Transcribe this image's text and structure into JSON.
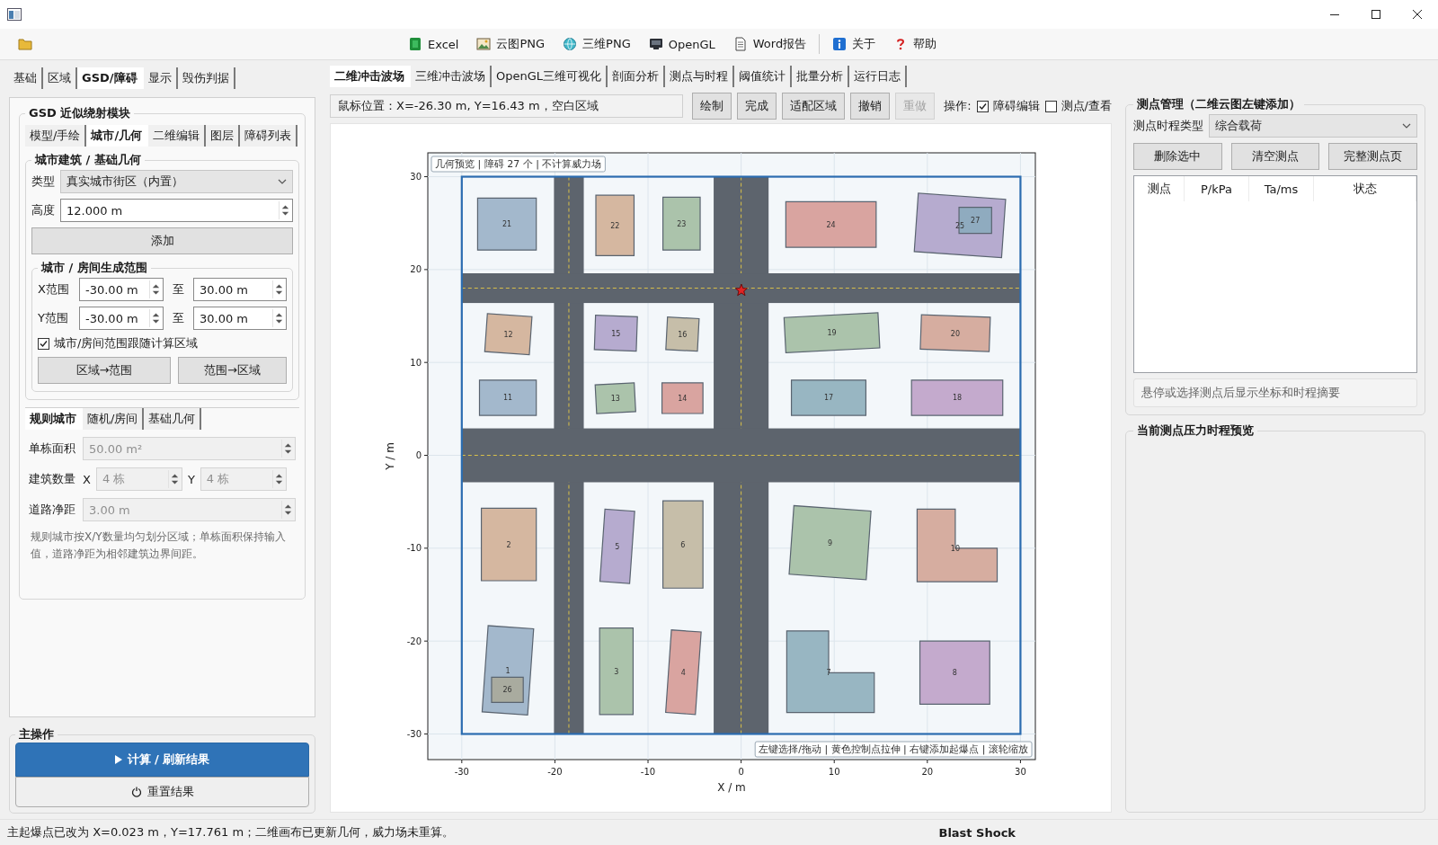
{
  "toolbar": {
    "groups": [
      [
        {
          "kind": "folder"
        }
      ],
      [
        {
          "kind": "excel",
          "label": "Excel"
        },
        {
          "kind": "image",
          "label": "云图PNG"
        },
        {
          "kind": "globe",
          "label": "三维PNG"
        },
        {
          "kind": "monitor",
          "label": "OpenGL"
        },
        {
          "kind": "document",
          "label": "Word报告"
        }
      ],
      [
        {
          "kind": "info",
          "label": "关于"
        },
        {
          "kind": "help",
          "label": "帮助"
        }
      ]
    ]
  },
  "left_panel": {
    "tabs": [
      {
        "label": "基础",
        "selected": false
      },
      {
        "label": "区域",
        "selected": false
      },
      {
        "label": "GSD/障碍",
        "selected": true
      },
      {
        "label": "显示",
        "selected": false
      },
      {
        "label": "毁伤判据",
        "selected": false
      }
    ],
    "module": {
      "title": "GSD 近似绕射模块",
      "tabs": [
        {
          "label": "模型/手绘",
          "selected": false
        },
        {
          "label": "城市/几何",
          "selected": true
        },
        {
          "label": "二维编辑",
          "selected": false
        },
        {
          "label": "图层",
          "selected": false
        },
        {
          "label": "障碍列表",
          "selected": false
        }
      ],
      "geometry": {
        "title": "城市建筑 / 基础几何",
        "type_label": "类型",
        "type_value": "真实城市街区（内置）",
        "height_label": "高度",
        "height_value": "12.000 m",
        "add_button": "添加"
      },
      "range": {
        "title": "城市 / 房间生成范围",
        "rows": [
          {
            "label": "X范围",
            "from": "-30.00 m",
            "to_label": "至",
            "to": "30.00 m"
          },
          {
            "label": "Y范围",
            "from": "-30.00 m",
            "to_label": "至",
            "to": "30.00 m"
          }
        ],
        "follow": {
          "label": "城市/房间范围跟随计算区域",
          "checked": true
        },
        "buttons": [
          "区域→范围",
          "范围→区域"
        ]
      },
      "city_tabs": [
        {
          "label": "规则城市",
          "selected": true
        },
        {
          "label": "随机/房间",
          "selected": false
        },
        {
          "label": "基础几何",
          "selected": false
        }
      ],
      "fields": [
        {
          "kind": "single",
          "label": "单栋面积",
          "value": "50.00 m²",
          "disabled": true
        },
        {
          "kind": "pair",
          "label": "建筑数量",
          "disabled": true,
          "items": [
            {
              "label": "X",
              "value": "4 栋"
            },
            {
              "label": "Y",
              "value": "4 栋"
            }
          ]
        },
        {
          "kind": "single",
          "label": "道路净距",
          "value": "3.00 m",
          "disabled": true
        }
      ],
      "note": "规则城市按X/Y数量均匀划分区域；单栋面积保持输入值，道路净距为相邻建筑边界间距。"
    },
    "main_actions": {
      "title": "主操作",
      "buttons": [
        {
          "kind": "primary",
          "label": "计算 / 刷新结果"
        },
        {
          "kind": "reset",
          "label": "重置结果"
        }
      ]
    }
  },
  "center": {
    "tabs": [
      {
        "label": "二维冲击波场",
        "selected": true
      },
      {
        "label": "三维冲击波场",
        "selected": false
      },
      {
        "label": "OpenGL三维可视化",
        "selected": false
      },
      {
        "label": "剖面分析",
        "selected": false
      },
      {
        "label": "测点与时程",
        "selected": false
      },
      {
        "label": "阈值统计",
        "selected": false
      },
      {
        "label": "批量分析",
        "selected": false
      },
      {
        "label": "运行日志",
        "selected": false
      }
    ],
    "toolbar": {
      "mouse_position": "鼠标位置：X=-26.30 m, Y=16.43 m，空白区域",
      "buttons": [
        {
          "label": "绘制",
          "disabled": false
        },
        {
          "label": "完成",
          "disabled": false
        },
        {
          "label": "适配区域",
          "disabled": false
        },
        {
          "label": "撤销",
          "disabled": false
        },
        {
          "label": "重做",
          "disabled": true
        }
      ],
      "mode_label": "操作:",
      "checks": [
        {
          "label": "障碍编辑",
          "checked": true
        },
        {
          "label": "测点/查看",
          "checked": false
        }
      ]
    },
    "plot": {
      "badge": "几何预览 | 障碍 27 个 | 不计算威力场",
      "hint": "左键选择/拖动 | 黄色控制点拉伸 | 右键添加起爆点 | 滚轮缩放",
      "xlabel": "X / m",
      "ylabel": "Y / m",
      "xticks": [
        "-30",
        "-20",
        "-10",
        "0",
        "10",
        "20",
        "30"
      ],
      "yticks": [
        "30",
        "20",
        "10",
        "0",
        "-10",
        "-20",
        "-30"
      ],
      "obstacles": [
        {
          "label": "21",
          "kind": "rect",
          "color": "#a3b8cc"
        },
        {
          "label": "22",
          "kind": "rect",
          "color": "#d5b7a0"
        },
        {
          "label": "23",
          "kind": "rect",
          "color": "#abc3ab"
        },
        {
          "label": "24",
          "kind": "rect",
          "color": "#d9a4a0"
        },
        {
          "label": "25",
          "kind": "rect",
          "color": "#b6abcf"
        },
        {
          "label": "27",
          "kind": "rect",
          "color": "#8fabbf"
        },
        {
          "label": "12",
          "kind": "rect",
          "color": "#d5b7a0"
        },
        {
          "label": "15",
          "kind": "rect",
          "color": "#b6abcf"
        },
        {
          "label": "16",
          "kind": "rect",
          "color": "#c6bea9"
        },
        {
          "label": "19",
          "kind": "rect",
          "color": "#abc3ab"
        },
        {
          "label": "20",
          "kind": "rect",
          "color": "#d6ada0"
        },
        {
          "label": "11",
          "kind": "rect",
          "color": "#a3b8cc"
        },
        {
          "label": "13",
          "kind": "rect",
          "color": "#abc3ab"
        },
        {
          "label": "14",
          "kind": "rect",
          "color": "#d9a4a0"
        },
        {
          "label": "17",
          "kind": "rect",
          "color": "#98b6c2"
        },
        {
          "label": "18",
          "kind": "rect",
          "color": "#c4aacd"
        },
        {
          "label": "2",
          "kind": "rect",
          "color": "#d5b7a0"
        },
        {
          "label": "5",
          "kind": "rect",
          "color": "#b6abcf"
        },
        {
          "label": "6",
          "kind": "rect",
          "color": "#c6bea9"
        },
        {
          "label": "9",
          "kind": "rect",
          "color": "#abc3ab"
        },
        {
          "label": "10",
          "kind": "lshape",
          "color": "#d6ada0"
        },
        {
          "label": "1",
          "kind": "rect",
          "color": "#a3b8cc"
        },
        {
          "label": "26",
          "kind": "rect",
          "color": "#a9ab9f"
        },
        {
          "label": "3",
          "kind": "rect",
          "color": "#abc3ab"
        },
        {
          "label": "4",
          "kind": "rect",
          "color": "#d9a4a0"
        },
        {
          "label": "7",
          "kind": "lshape",
          "color": "#98b6c2"
        },
        {
          "label": "8",
          "kind": "rect",
          "color": "#c4aacd"
        }
      ]
    }
  },
  "right_panel": {
    "probes": {
      "title": "测点管理（二维云图左键添加）",
      "type_label": "测点时程类型",
      "type_value": "综合载荷",
      "buttons": [
        "删除选中",
        "清空测点",
        "完整测点页"
      ],
      "columns": [
        "测点",
        "P/kPa",
        "Ta/ms",
        "状态"
      ],
      "hint": "悬停或选择测点后显示坐标和时程摘要"
    },
    "preview": {
      "title": "当前测点压力时程预览"
    }
  },
  "status_bar": {
    "message": "主起爆点已改为 X=0.023 m，Y=17.761 m；二维画布已更新几何，威力场未重算。",
    "app": "Blast Shock"
  }
}
